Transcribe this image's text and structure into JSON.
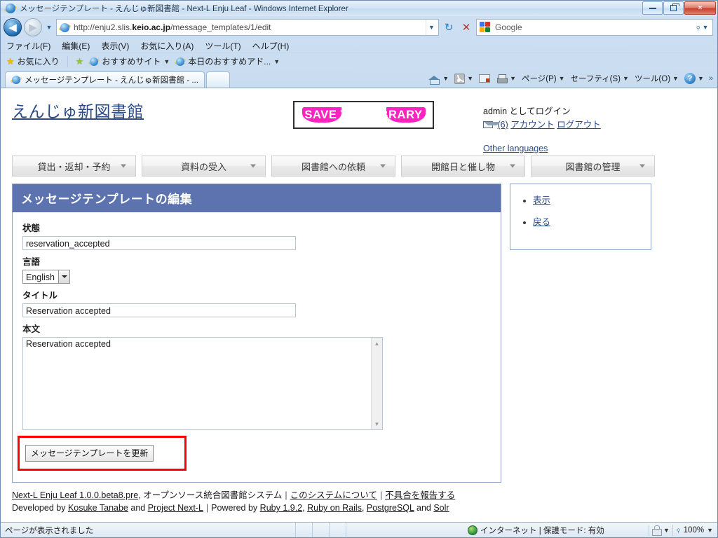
{
  "window": {
    "title": "メッセージテンプレート - えんじゅ新図書館 - Next-L Enju Leaf - Windows Internet Explorer",
    "minimize_label": "最小化",
    "restore_label": "元のサイズに戻す",
    "close_label": "×"
  },
  "address_bar": {
    "url_prefix": "http://enju2.slis.",
    "url_domain": "keio.ac.jp",
    "url_suffix": "/message_templates/1/edit",
    "back_glyph": "◀",
    "forward_glyph": "▶",
    "refresh_glyph": "↻",
    "stop_glyph": "✕"
  },
  "search": {
    "value": "Google",
    "magnifier": "⌕"
  },
  "menubar": {
    "items": [
      "ファイル(F)",
      "編集(E)",
      "表示(V)",
      "お気に入り(A)",
      "ツール(T)",
      "ヘルプ(H)"
    ]
  },
  "favbar": {
    "favorites_label": "お気に入り",
    "suggested_sites": "おすすめサイト",
    "todays_addon": "本日のおすすめアド..."
  },
  "tabstrip": {
    "tab_title": "メッセージテンプレート - えんじゅ新図書館 - ...",
    "new_tab_label": ""
  },
  "toolbar": {
    "items": [
      "ページ(P)",
      "セーフティ(S)",
      "ツール(O)"
    ],
    "help_glyph": "?",
    "more_glyph": "»"
  },
  "site": {
    "title": "えんじゅ新図書館",
    "banner_text": "SAVE THE LIBRARY",
    "login_text": "admin としてログイン",
    "message_count": "(6)",
    "account_link": "アカウント",
    "logout_link": "ログアウト",
    "other_languages": "Other languages"
  },
  "nav_tabs": [
    {
      "label": "貸出・返却・予約"
    },
    {
      "label": "資料の受入"
    },
    {
      "label": "図書館への依頼"
    },
    {
      "label": "開館日と催し物"
    },
    {
      "label": "図書館の管理"
    }
  ],
  "main": {
    "panel_title": "メッセージテンプレートの編集",
    "fields": {
      "status_label": "状態",
      "status_value": "reservation_accepted",
      "locale_label": "言語",
      "locale_value": "English",
      "title_label": "タイトル",
      "title_value": "Reservation accepted",
      "body_label": "本文",
      "body_value": "Reservation accepted"
    },
    "submit_label": "メッセージテンプレートを更新"
  },
  "sidebar": {
    "items": [
      {
        "label": "表示"
      },
      {
        "label": "戻る"
      }
    ]
  },
  "footer": {
    "app_name": "Next-L Enju Leaf 1.0.0.beta8.pre",
    "tagline": ", オープンソース統合図書館システム",
    "about_link": "このシステムについて",
    "report_link": "不具合を報告する",
    "developed_by": "Developed by",
    "author": "Kosuke Tanabe",
    "and": "and",
    "project": "Project Next-L",
    "powered_by": "Powered by",
    "ruby": "Ruby 1.9.2",
    "rails": "Ruby on Rails",
    "postgres": "PostgreSQL",
    "and2": "and",
    "solr": "Solr"
  },
  "statusbar": {
    "message": "ページが表示されました",
    "zone": "インターネット | 保護モード: 有効",
    "zoom": "100%"
  },
  "colors": {
    "panel_header": "#5c73b0",
    "link": "#2b4a86",
    "banner_pink": "#ff22c0",
    "highlight_red": "#ff0000"
  }
}
